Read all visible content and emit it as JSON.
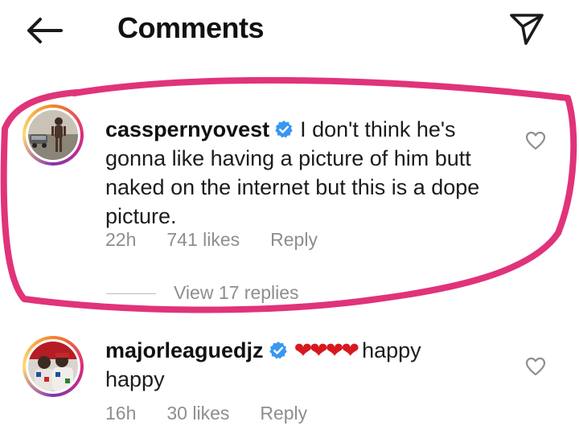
{
  "header": {
    "title": "Comments",
    "back_icon": "arrow-left-icon",
    "send_icon": "paper-plane-icon"
  },
  "comments": [
    {
      "username": "cassper­nyovest",
      "verified": true,
      "text": "I don't think he's gonna like having a picture of him butt naked on the internet but this is a dope picture.",
      "line1": "I don't think he's",
      "line2": "gonna like having a picture of him butt",
      "line3": "naked on the internet but this is a dope",
      "line4": "picture.",
      "time": "22h",
      "likes": "741 likes",
      "reply": "Reply",
      "view_replies": "View 17 replies"
    },
    {
      "username": "majorleaguedjz",
      "verified": true,
      "hearts": "❤❤❤❤",
      "line1": "happy",
      "line2": "happy",
      "time": "16h",
      "likes": "30 likes",
      "reply": "Reply"
    }
  ],
  "colors": {
    "highlight": "#e0337a",
    "verified": "#3897f0",
    "heart": "#d7191f",
    "meta": "#8e8e8e"
  }
}
